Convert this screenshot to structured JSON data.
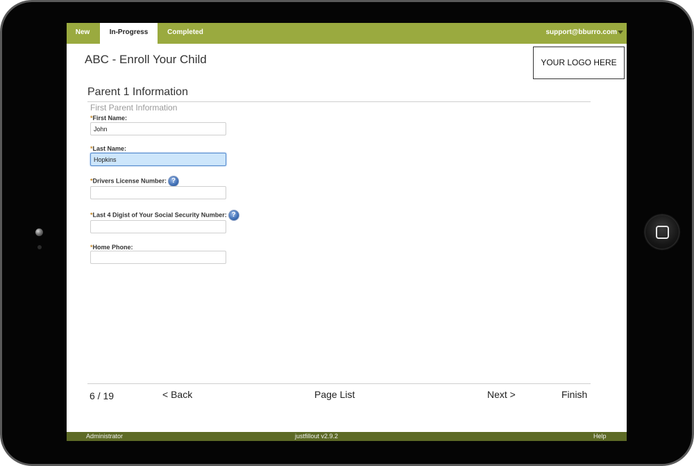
{
  "tabs": [
    {
      "label": "New"
    },
    {
      "label": "In-Progress"
    },
    {
      "label": "Completed"
    }
  ],
  "account": {
    "email": "support@bburro.com"
  },
  "app_title": "ABC - Enroll Your Child",
  "logo_text": "YOUR LOGO HERE",
  "section": {
    "title": "Parent 1 Information",
    "subtitle": "First Parent Information"
  },
  "fields": [
    {
      "required_mark": "*",
      "label": "First Name:",
      "value": "John",
      "help": false
    },
    {
      "required_mark": "*",
      "label": "Last Name:",
      "value": "Hopkins",
      "help": false,
      "focused": true
    },
    {
      "required_mark": "*",
      "label": "Drivers License Number:",
      "value": "",
      "help": true
    },
    {
      "required_mark": "*",
      "label": "Last 4 Digist of Your Social Security Number:",
      "value": "",
      "help": true
    },
    {
      "required_mark": "*",
      "label": "Home Phone:",
      "value": "",
      "help": false
    }
  ],
  "help_glyph": "?",
  "pager": {
    "page_count": "6 / 19",
    "back": "< Back",
    "page_list": "Page List",
    "next": "Next >",
    "finish": "Finish"
  },
  "status_bar": {
    "left": "Administrator",
    "center": "justfillout v2.9.2",
    "right": "Help"
  },
  "colors": {
    "topbar": "#9aaa3f",
    "bottombar": "#5d6a26",
    "required": "#c58a2c",
    "focused_input": "#cde6fb"
  },
  "icons": {
    "help": "question-circle-icon",
    "dropdown": "caret-down-icon",
    "home": "home-button-icon"
  }
}
